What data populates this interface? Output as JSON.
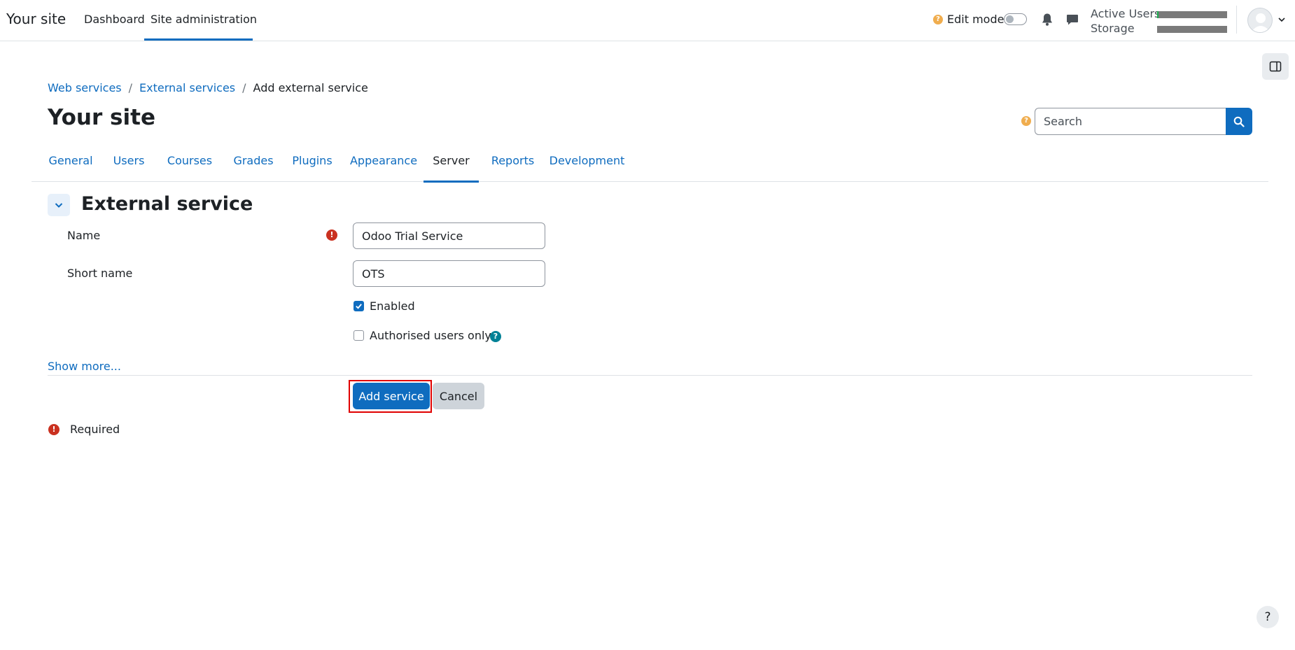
{
  "navbar": {
    "brand": "Your site",
    "primary_nav": [
      {
        "label": "Dashboard",
        "active": false
      },
      {
        "label": "Site administration",
        "active": true
      }
    ],
    "edit_mode_help": "?",
    "edit_mode_label": "Edit mode",
    "edit_mode_on": false,
    "usage": {
      "active_users_label": "Active Users",
      "active_users_fraction": 0.02,
      "storage_label": "Storage",
      "storage_fraction": 0.0
    }
  },
  "breadcrumb": [
    {
      "label": "Web services",
      "link": true
    },
    {
      "label": "External services",
      "link": true
    },
    {
      "label": "Add external service",
      "link": false
    }
  ],
  "breadcrumb_separator": "/",
  "header": {
    "page_title": "Your site",
    "search_help": "?",
    "search_placeholder": "Search"
  },
  "tabs": [
    {
      "label": "General",
      "active": false
    },
    {
      "label": "Users",
      "active": false
    },
    {
      "label": "Courses",
      "active": false
    },
    {
      "label": "Grades",
      "active": false
    },
    {
      "label": "Plugins",
      "active": false
    },
    {
      "label": "Appearance",
      "active": false
    },
    {
      "label": "Server",
      "active": true
    },
    {
      "label": "Reports",
      "active": false
    },
    {
      "label": "Development",
      "active": false
    }
  ],
  "form": {
    "section_title": "External service",
    "name_label": "Name",
    "name_value": "Odoo Trial Service",
    "shortname_label": "Short name",
    "shortname_value": "OTS",
    "enabled_label": "Enabled",
    "enabled_checked": true,
    "authorised_label": "Authorised users only",
    "authorised_checked": false,
    "info_help": "?",
    "show_more": "Show more...",
    "required_mark": "!",
    "submit_label": "Add service",
    "cancel_label": "Cancel",
    "required_legend": "Required"
  },
  "footer": {
    "help_label": "?"
  },
  "colors": {
    "primary": "#0f6cbf",
    "required": "#ca3120",
    "help_warning": "#f0ad4e",
    "help_info": "#008196",
    "highlight": "#e00000"
  }
}
